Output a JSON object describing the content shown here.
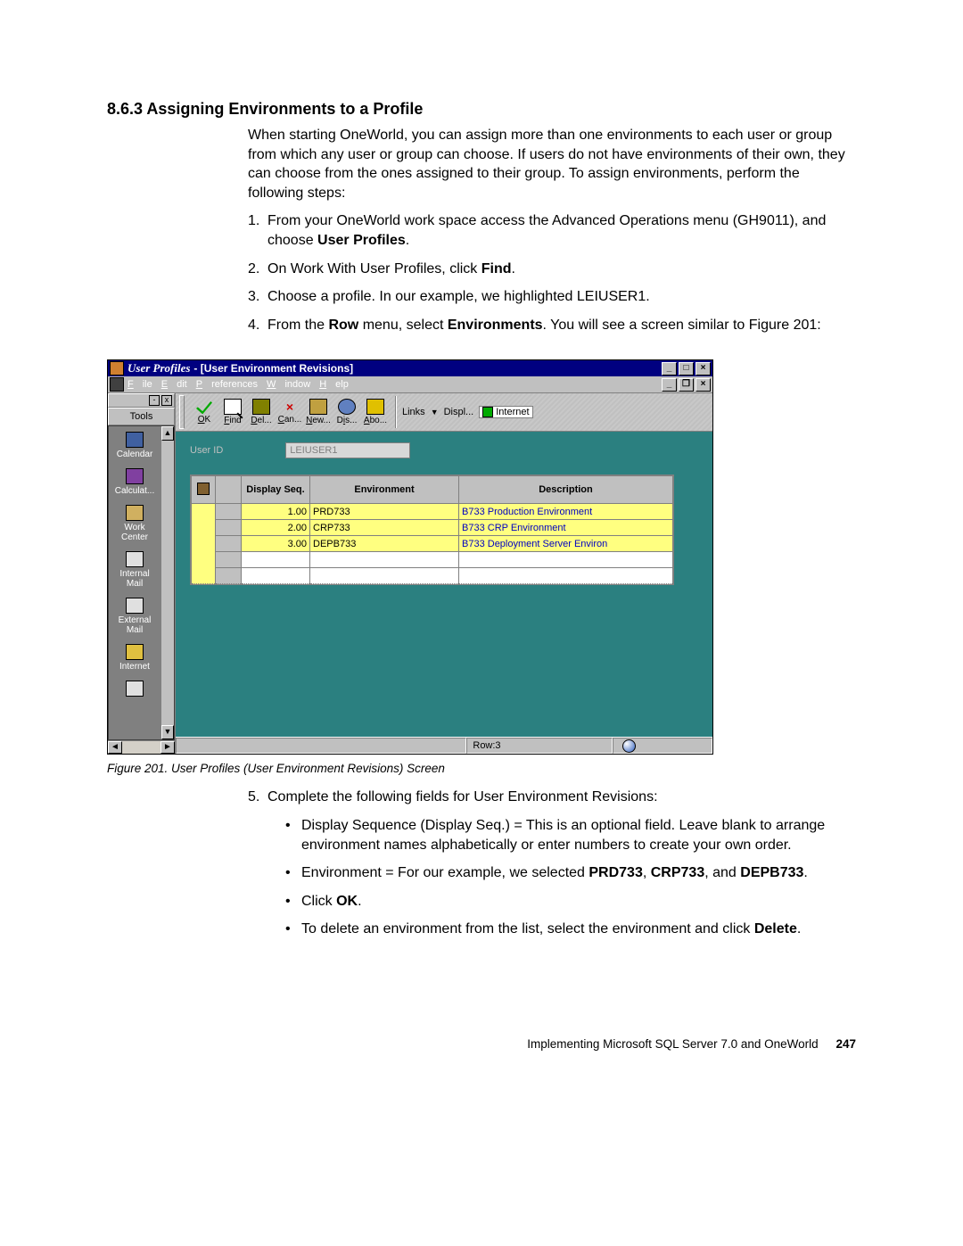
{
  "heading": "8.6.3  Assigning Environments to a Profile",
  "intro": "When starting OneWorld, you can assign more than one environments to each user or group from which any user or group can choose. If users do not have environments of their own, they can choose from the ones assigned to their group. To assign environments, perform the following steps:",
  "steps": {
    "s1a": "From your OneWorld work space access the Advanced Operations menu (GH9011), and choose ",
    "s1b": "User Profiles",
    "s1c": ".",
    "s2a": "On Work With User Profiles, click ",
    "s2b": "Find",
    "s2c": ".",
    "s3": "Choose a profile. In our example, we highlighted LEIUSER1.",
    "s4a": "From the ",
    "s4b": "Row",
    "s4c": " menu, select ",
    "s4d": "Environments",
    "s4e": ". You will see a screen similar to Figure 201:",
    "s5": "Complete the following fields for User Environment Revisions:"
  },
  "bullets": {
    "b1": "Display Sequence (Display Seq.) = This is an optional field. Leave blank to arrange environment names alphabetically or enter numbers to create your own order.",
    "b2a": "Environment = For our example, we selected ",
    "b2b": "PRD733",
    "b2c": ", ",
    "b2d": "CRP733",
    "b2e": ", and ",
    "b2f": "DEPB733",
    "b2g": ".",
    "b3a": "Click ",
    "b3b": "OK",
    "b3c": ".",
    "b4a": "To delete an environment from the list, select the environment and click ",
    "b4b": "Delete",
    "b4c": "."
  },
  "caption": "Figure 201.  User Profiles (User Environment Revisions) Screen",
  "footer_text": "Implementing Microsoft SQL Server 7.0 and OneWorld",
  "footer_page": "247",
  "window": {
    "title_app": "User Profiles",
    "title_sep": "  - ",
    "title_doc": "[User Environment Revisions]",
    "menus": {
      "file": "File",
      "edit": "Edit",
      "prefs": "Preferences",
      "window": "Window",
      "help": "Help"
    },
    "tools_label": "Tools",
    "sidebar": {
      "calendar": "Calendar",
      "calculat": "Calculat...",
      "work1": "Work",
      "work2": "Center",
      "im1": "Internal",
      "im2": "Mail",
      "em1": "External",
      "em2": "Mail",
      "internet": "Internet"
    },
    "toolbar": {
      "ok": "OK",
      "find": "Find",
      "del": "Del...",
      "can": "Can...",
      "new": "New...",
      "dis": "Dis...",
      "abo": "Abo...",
      "links": "Links",
      "displ": "Displ...",
      "internet": "Internet"
    },
    "form": {
      "userid_label": "User ID",
      "userid_value": "LEIUSER1"
    },
    "grid": {
      "h_seq": "Display Seq.",
      "h_env": "Environment",
      "h_desc": "Description",
      "r1": {
        "seq": "1.00",
        "env": "PRD733",
        "desc": "B733 Production Environment"
      },
      "r2": {
        "seq": "2.00",
        "env": "CRP733",
        "desc": "B733 CRP Environment"
      },
      "r3": {
        "seq": "3.00",
        "env": "DEPB733",
        "desc": "B733 Deployment Server Environ"
      }
    },
    "status": "Row:3"
  }
}
